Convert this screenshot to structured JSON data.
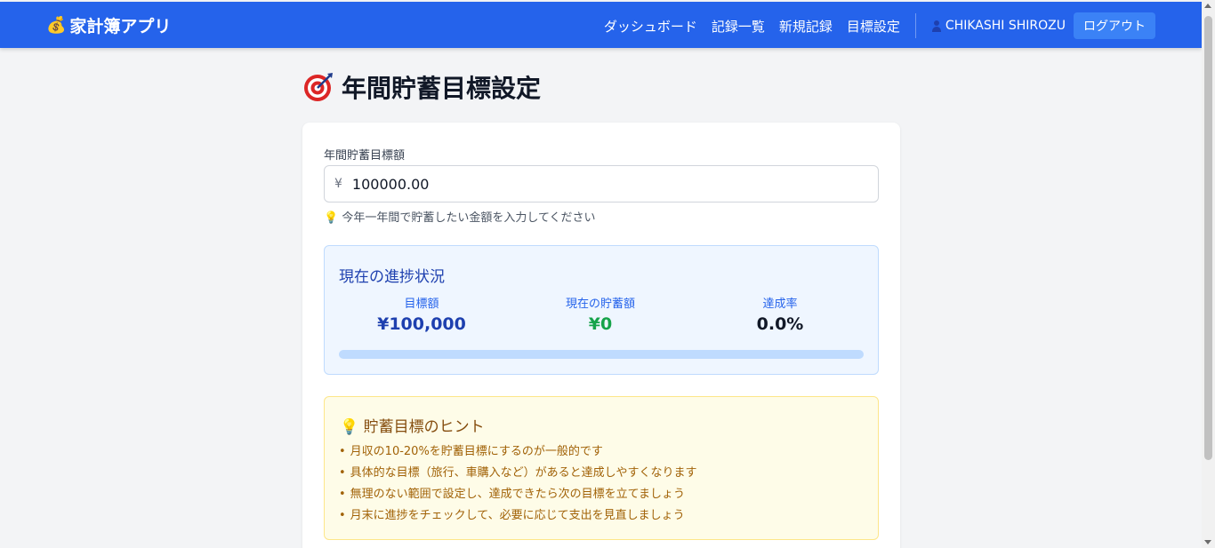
{
  "header": {
    "app_icon": "money-bag-icon",
    "app_title": "家計簿アプリ",
    "nav": [
      "ダッシュボード",
      "記録一覧",
      "新規記録",
      "目標設定"
    ],
    "user_icon": "user-icon",
    "user_name": "CHIKASHI SHIROZU",
    "logout_label": "ログアウト",
    "accent_color": "#2563eb"
  },
  "page": {
    "title_icon": "target-icon",
    "title": "年間貯蓄目標設定"
  },
  "form": {
    "field_label": "年間貯蓄目標額",
    "currency_symbol": "¥",
    "amount_value": "100000.00",
    "hint_icon": "lightbulb-icon",
    "hint": "今年一年間で貯蓄したい金額を入力してください"
  },
  "progress": {
    "title": "現在の進捗状況",
    "stats": [
      {
        "label": "目標額",
        "value": "¥100,000",
        "color": "#1e40af"
      },
      {
        "label": "現在の貯蓄額",
        "value": "¥0",
        "color": "#16a34a"
      },
      {
        "label": "達成率",
        "value": "0.0%",
        "color": "#111827"
      }
    ],
    "percent_achieved": 0
  },
  "tips": {
    "icon": "lightbulb-icon",
    "title": "貯蓄目標のヒント",
    "items": [
      "月収の10-20%を貯蓄目標にするのが一般的です",
      "具体的な目標（旅行、車購入など）があると達成しやすくなります",
      "無理のない範囲で設定し、達成できたら次の目標を立てましょう",
      "月末に進捗をチェックして、必要に応じて支出を見直しましょう"
    ]
  }
}
